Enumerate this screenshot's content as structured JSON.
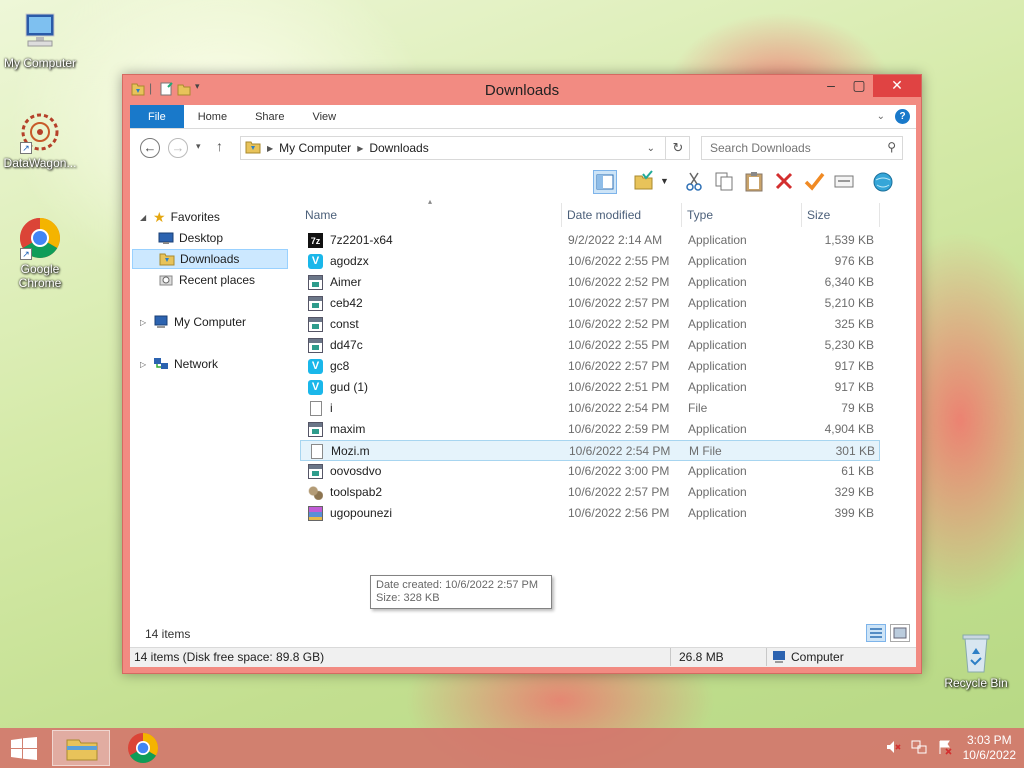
{
  "desktop": {
    "icons": [
      {
        "label": "My Computer"
      },
      {
        "label": "DataWagon..."
      },
      {
        "label": "Google Chrome"
      },
      {
        "label": "Recycle Bin"
      }
    ]
  },
  "window": {
    "title": "Downloads",
    "ribbon_tabs": {
      "file": "File",
      "home": "Home",
      "share": "Share",
      "view": "View"
    },
    "address": {
      "crumb1": "My Computer",
      "crumb2": "Downloads"
    },
    "search_placeholder": "Search Downloads"
  },
  "nav": {
    "favorites": "Favorites",
    "desktop": "Desktop",
    "downloads": "Downloads",
    "recent": "Recent places",
    "computer": "My Computer",
    "network": "Network"
  },
  "columns": {
    "name": "Name",
    "date": "Date modified",
    "type": "Type",
    "size": "Size"
  },
  "files": [
    {
      "name": "7z2201-x64",
      "date": "9/2/2022 2:14 AM",
      "type": "Application",
      "size": "1,539 KB",
      "icon": "7z-icon"
    },
    {
      "name": "agodzx",
      "date": "10/6/2022 2:55 PM",
      "type": "Application",
      "size": "976 KB",
      "icon": "v-icon"
    },
    {
      "name": "Aimer",
      "date": "10/6/2022 2:52 PM",
      "type": "Application",
      "size": "6,340 KB",
      "icon": "app-icon"
    },
    {
      "name": "ceb42",
      "date": "10/6/2022 2:57 PM",
      "type": "Application",
      "size": "5,210 KB",
      "icon": "app-icon"
    },
    {
      "name": "const",
      "date": "10/6/2022 2:52 PM",
      "type": "Application",
      "size": "325 KB",
      "icon": "app-icon"
    },
    {
      "name": "dd47c",
      "date": "10/6/2022 2:55 PM",
      "type": "Application",
      "size": "5,230 KB",
      "icon": "app-icon"
    },
    {
      "name": "gc8",
      "date": "10/6/2022 2:57 PM",
      "type": "Application",
      "size": "917 KB",
      "icon": "v-icon"
    },
    {
      "name": "gud (1)",
      "date": "10/6/2022 2:51 PM",
      "type": "Application",
      "size": "917 KB",
      "icon": "v-icon"
    },
    {
      "name": "i",
      "date": "10/6/2022 2:54 PM",
      "type": "File",
      "size": "79 KB",
      "icon": "file-icon"
    },
    {
      "name": "maxim",
      "date": "10/6/2022 2:59 PM",
      "type": "Application",
      "size": "4,904 KB",
      "icon": "app-icon"
    },
    {
      "name": "Mozi.m",
      "date": "10/6/2022 2:54 PM",
      "type": "M File",
      "size": "301 KB",
      "icon": "file-icon"
    },
    {
      "name": "oovosdvo",
      "date": "10/6/2022 3:00 PM",
      "type": "Application",
      "size": "61 KB",
      "icon": "app-icon"
    },
    {
      "name": "toolspab2",
      "date": "10/6/2022 2:57 PM",
      "type": "Application",
      "size": "329 KB",
      "icon": "tools-icon"
    },
    {
      "name": "ugopounezi",
      "date": "10/6/2022 2:56 PM",
      "type": "Application",
      "size": "399 KB",
      "icon": "archive-icon"
    }
  ],
  "tooltip": {
    "line1": "Date created: 10/6/2022 2:57 PM",
    "line2": "Size: 328 KB"
  },
  "status": {
    "items": "14 items",
    "disk": "14 items (Disk free space: 89.8 GB)",
    "total": "26.8 MB",
    "location": "Computer"
  },
  "clock": {
    "time": "3:03 PM",
    "date": "10/6/2022"
  },
  "colors": {
    "accent": "#1979ca",
    "window_frame": "#f28b82",
    "close": "#e04343"
  }
}
